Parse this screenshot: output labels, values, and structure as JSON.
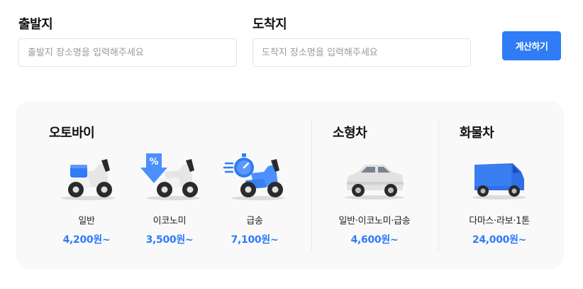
{
  "form": {
    "origin": {
      "label": "출발지",
      "placeholder": "출발지 장소명을 입력해주세요",
      "value": ""
    },
    "destination": {
      "label": "도착지",
      "placeholder": "도착지 장소명을 입력해주세요",
      "value": ""
    },
    "calculate_label": "계산하기"
  },
  "colors": {
    "accent": "#2f7cf6",
    "panel_bg": "#f9f9f9"
  },
  "sections": {
    "motorcycle": {
      "title": "오토바이",
      "items": [
        {
          "name": "일반",
          "price": "4,200원~",
          "icon": "delivery-scooter-icon"
        },
        {
          "name": "이코노미",
          "price": "3,500원~",
          "icon": "discount-scooter-icon"
        },
        {
          "name": "급송",
          "price": "7,100원~",
          "icon": "express-scooter-icon"
        }
      ]
    },
    "small_car": {
      "title": "소형차",
      "items": [
        {
          "name": "일반·이코노미·급송",
          "price": "4,600원~",
          "icon": "car-icon"
        }
      ]
    },
    "truck": {
      "title": "화물차",
      "items": [
        {
          "name": "다마스·라보·1톤",
          "price": "24,000원~",
          "icon": "van-icon"
        }
      ]
    }
  }
}
